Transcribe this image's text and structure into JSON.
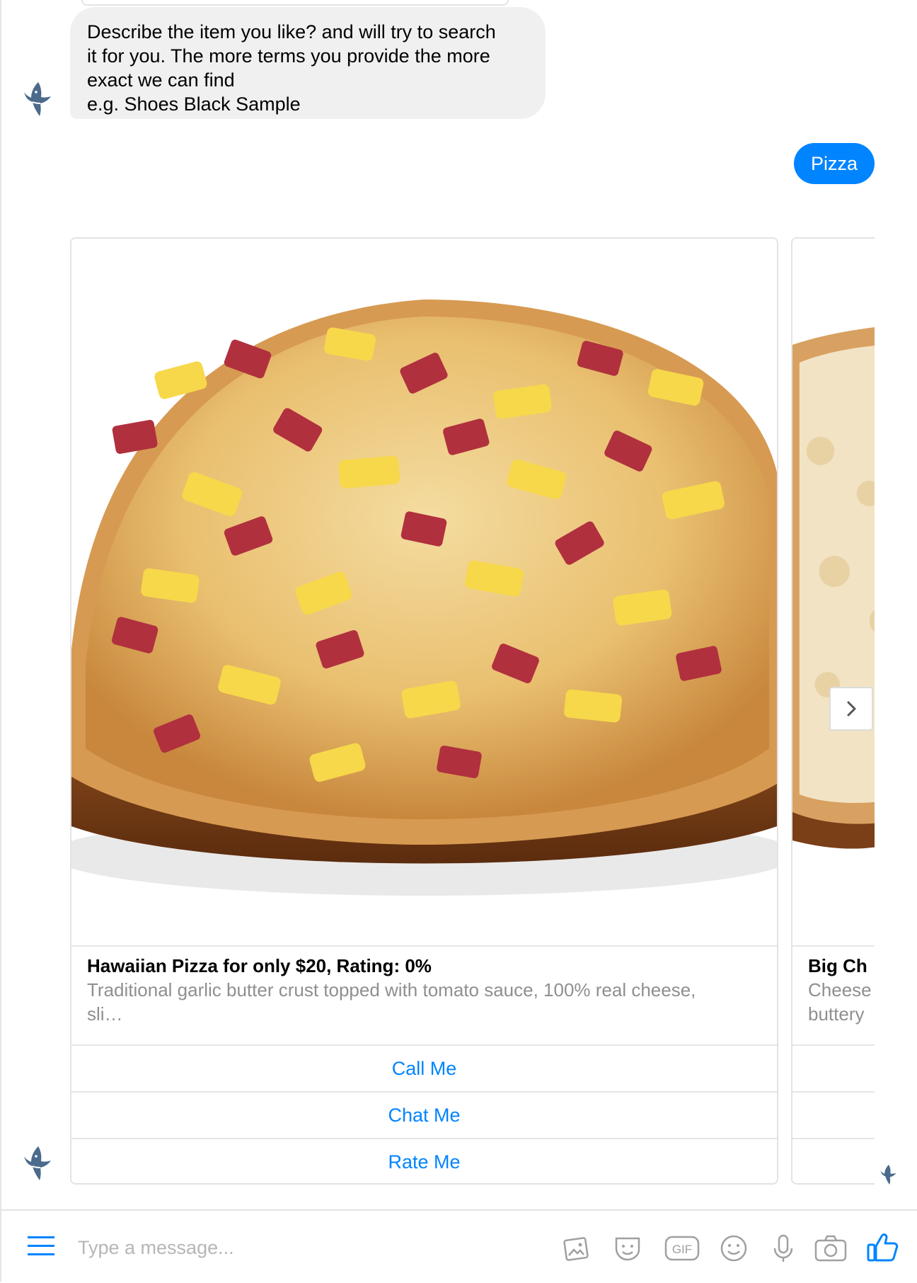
{
  "conversation": {
    "bot_message_lines": [
      "Describe the item you like? and will try to search",
      "it for you. The more terms you provide the more",
      "exact we can find",
      "e.g. Shoes Black Sample"
    ],
    "user_message": "Pizza"
  },
  "carousel": {
    "cards": [
      {
        "image": "pizza-photo",
        "title": "Hawaiian Pizza for only $20, Rating: 0%",
        "subtitle_line1": "Traditional garlic butter crust topped with tomato sauce, 100% real cheese,",
        "subtitle_line2": "sli…",
        "buttons": [
          "Call Me",
          "Chat Me",
          "Rate Me"
        ]
      },
      {
        "image": "pizza-photo",
        "title": "Big Ch",
        "subtitle_line1": "Cheese",
        "subtitle_line2": "buttery"
      }
    ],
    "next_icon": "chevron-right-icon"
  },
  "composer": {
    "placeholder": "Type a message...",
    "icons": [
      "menu-icon",
      "image-icon",
      "sticker-icon",
      "gif-icon",
      "emoji-icon",
      "microphone-icon",
      "camera-icon",
      "thumbs-up-icon"
    ],
    "gif_label": "GIF"
  },
  "colors": {
    "accent": "#0084ff",
    "bot_bubble": "#f1f0f0",
    "border": "#e3e3e3"
  }
}
